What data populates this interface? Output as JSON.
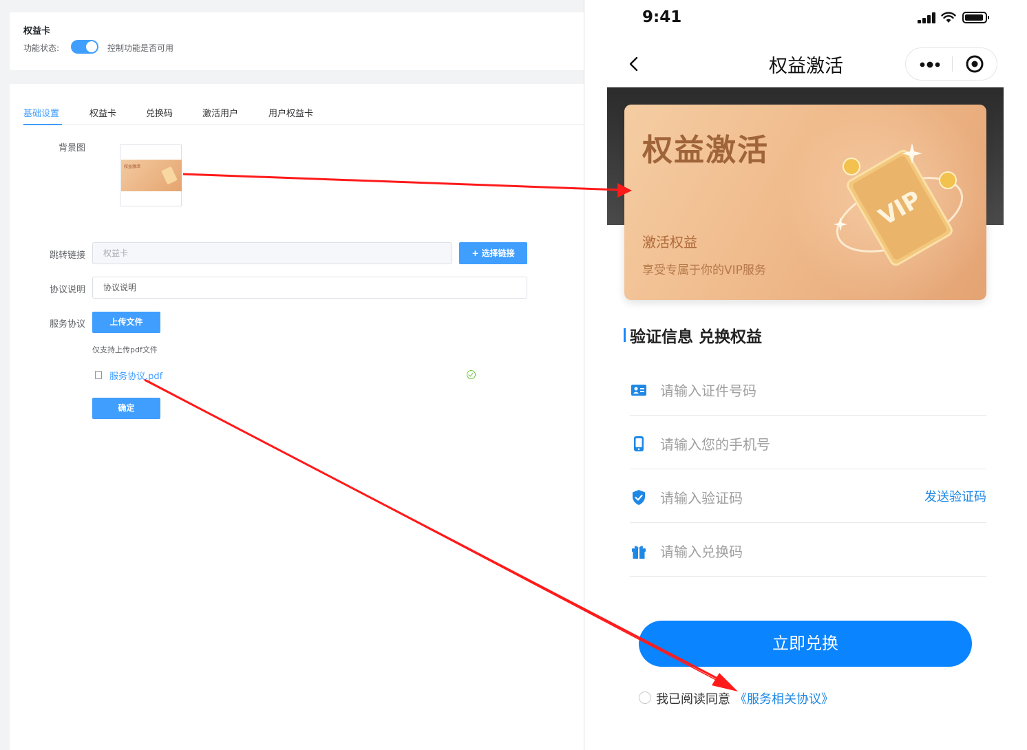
{
  "admin": {
    "title": "权益卡",
    "status_label": "功能状态:",
    "status_enabled": true,
    "status_hint": "控制功能是否可用",
    "tabs": [
      {
        "label": "基础设置",
        "active": true
      },
      {
        "label": "权益卡",
        "active": false
      },
      {
        "label": "兑换码",
        "active": false
      },
      {
        "label": "激活用户",
        "active": false
      },
      {
        "label": "用户权益卡",
        "active": false
      }
    ],
    "form": {
      "bg_label": "背景图",
      "link_label": "跳转链接",
      "link_value": "权益卡",
      "choose_link_button": "+ 选择链接",
      "agreement_desc_label": "协议说明",
      "agreement_desc_value": "协议说明",
      "service_label": "服务协议",
      "upload_button": "上传文件",
      "upload_tip": "仅支持上传pdf文件",
      "file_name": "服务协议.pdf",
      "confirm_button": "确定"
    },
    "thumb_text": "权益激活"
  },
  "phone": {
    "status_time": "9:41",
    "nav_title": "权益激活",
    "banner": {
      "title": "权益激活",
      "subtitle": "激活权益",
      "desc": "享受专属于你的VIP服务"
    },
    "section_title": "验证信息  兑换权益",
    "fields": {
      "id_placeholder": "请输入证件号码",
      "phone_placeholder": "请输入您的手机号",
      "code_placeholder": "请输入验证码",
      "send_code": "发送验证码",
      "redeem_placeholder": "请输入兑换码"
    },
    "redeem_button": "立即兑换",
    "agree_text": "我已阅读同意",
    "agree_link": "《服务相关协议》"
  },
  "colors": {
    "admin_primary": "#409eff",
    "phone_primary": "#0a84ff",
    "annotation_arrow": "#ff1a1a",
    "banner_gold": "#efb98a"
  }
}
